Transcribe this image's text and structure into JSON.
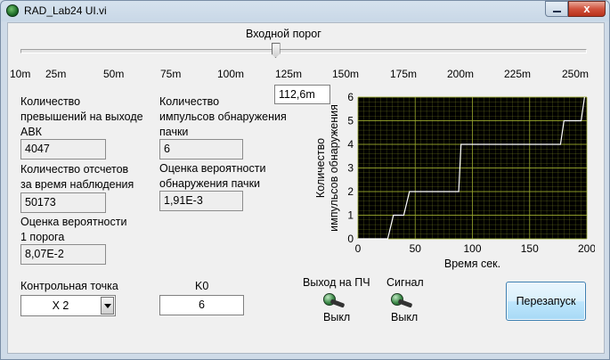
{
  "window": {
    "title": "RAD_Lab24 UI.vi",
    "close_glyph": "x"
  },
  "threshold": {
    "label": "Входной порог",
    "value": 0.4505,
    "value_text": "112,6m",
    "ticks": [
      "10m",
      "25m",
      "50m",
      "75m",
      "100m",
      "125m",
      "150m",
      "175m",
      "200m",
      "225m",
      "250m"
    ]
  },
  "left": {
    "exceed_label": [
      "Количество",
      "превышений на выходе",
      "АВК"
    ],
    "exceed_value": "4047",
    "samples_label": [
      "Количество отсчетов",
      "за время наблюдения"
    ],
    "samples_value": "50173",
    "prob1_label": [
      "Оценка вероятности",
      "1 порога"
    ],
    "prob1_value": "8,07E-2"
  },
  "middle": {
    "pulses_label": [
      "Количество",
      "импульсов обнаружения",
      "пачки"
    ],
    "pulses_value": "6",
    "probdet_label": [
      "Оценка вероятности",
      "обнаружения пачки"
    ],
    "probdet_value": "1,91E-3"
  },
  "controls": {
    "checkpoint_label": "Контрольная точка",
    "checkpoint_value": "X 2",
    "k0_label": "K0",
    "k0_value": "6",
    "pch_label": "Выход на ПЧ",
    "pch_state": "Выкл",
    "signal_label": "Сигнал",
    "signal_state": "Выкл",
    "restart_label": "Перезапуск"
  },
  "colors": {
    "plot_bg": "#000000",
    "grid": "#9aa82e",
    "trace": "#ffffff"
  },
  "chart_data": {
    "type": "line",
    "xlabel": "Время сек.",
    "ylabel": [
      "Количество",
      "импульсов обнаружения"
    ],
    "xlim": [
      0,
      200
    ],
    "ylim": [
      0,
      6
    ],
    "x_ticks": [
      "0",
      "50",
      "100",
      "150",
      "200"
    ],
    "y_ticks": [
      "0",
      "1",
      "2",
      "3",
      "4",
      "5",
      "6"
    ],
    "grid": true,
    "series": [
      {
        "x": [
          0,
          26,
          31,
          40,
          45,
          88,
          90,
          177,
          180,
          195,
          198
        ],
        "y": [
          0,
          0,
          1,
          1,
          2,
          2,
          4,
          4,
          5,
          5,
          6
        ]
      }
    ]
  }
}
